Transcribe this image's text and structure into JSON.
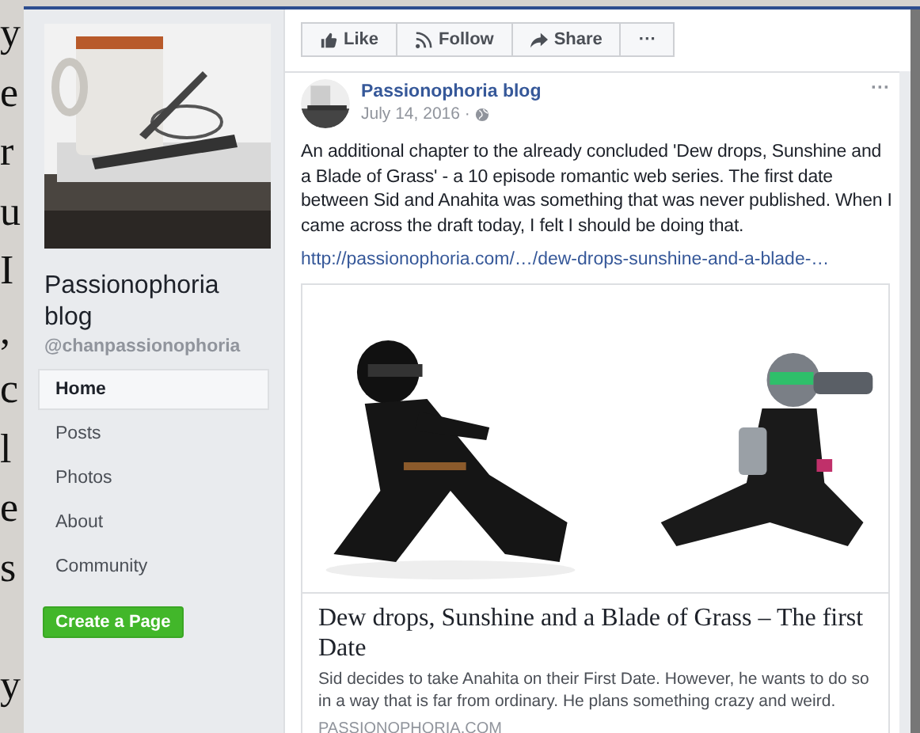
{
  "margin_letters": [
    [
      "y",
      "e",
      "r",
      "u",
      "I",
      ",",
      "c",
      "l",
      "e",
      "s"
    ],
    [
      "y"
    ]
  ],
  "page": {
    "name": "Passionophoria blog",
    "handle": "@chanpassionophoria",
    "nav": [
      {
        "label": "Home",
        "selected": true
      },
      {
        "label": "Posts",
        "selected": false
      },
      {
        "label": "Photos",
        "selected": false
      },
      {
        "label": "About",
        "selected": false
      },
      {
        "label": "Community",
        "selected": false
      }
    ],
    "create_button": "Create a Page"
  },
  "actions": [
    {
      "kind": "like",
      "label": "Like"
    },
    {
      "kind": "follow",
      "label": "Follow"
    },
    {
      "kind": "share",
      "label": "Share"
    },
    {
      "kind": "more",
      "label": "···"
    }
  ],
  "post": {
    "author": "Passionophoria blog",
    "date": "July 14, 2016 ·",
    "more": "···",
    "text": "An additional chapter to the already concluded 'Dew drops, Sunshine and a Blade of Grass' - a 10 episode romantic web series. The first date between Sid and Anahita was something that was never published. When I came across the draft today, I felt I should be doing that.",
    "link": "http://passionophoria.com/…/dew-drops-sunshine-and-a-blade-…",
    "preview": {
      "title": "Dew drops, Sunshine and a Blade of Grass – The first Date",
      "description": "Sid decides to take Anahita on their First Date. However, he wants to do so in a way that is far from ordinary. He plans something crazy and weird.",
      "domain": "PASSIONOPHORIA.COM"
    }
  }
}
